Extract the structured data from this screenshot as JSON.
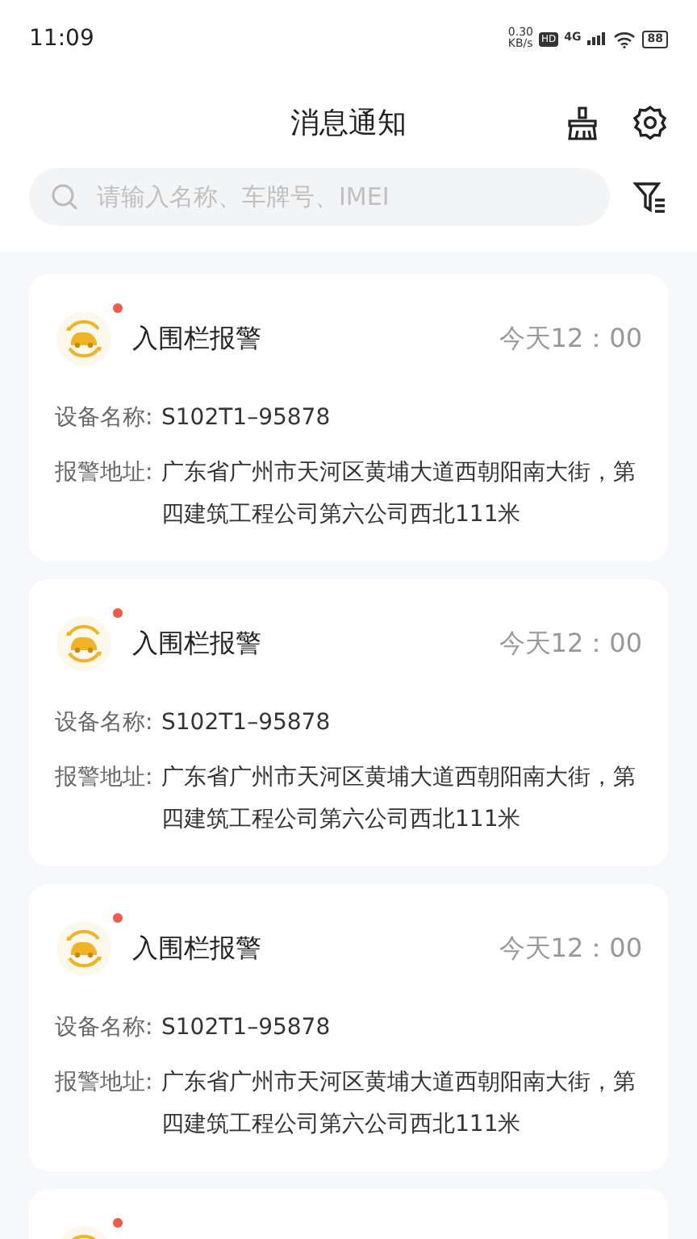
{
  "status_bar": {
    "time": "11:09",
    "speed": "0.30",
    "speed_unit": "KB/s",
    "hd": "HD",
    "network": "4G",
    "battery": "88"
  },
  "header": {
    "title": "消息通知"
  },
  "search": {
    "placeholder": "请输入名称、车牌号、IMEI"
  },
  "messages": [
    {
      "title": "入围栏报警",
      "time": "今天12：00",
      "unread": true,
      "fields": [
        {
          "label": "设备名称:",
          "value": "S102T1–95878"
        },
        {
          "label": "报警地址:",
          "value": "广东省广州市天河区黄埔大道西朝阳南大街，第四建筑工程公司第六公司西北111米"
        }
      ]
    },
    {
      "title": "入围栏报警",
      "time": "今天12：00",
      "unread": true,
      "fields": [
        {
          "label": "设备名称:",
          "value": "S102T1–95878"
        },
        {
          "label": "报警地址:",
          "value": "广东省广州市天河区黄埔大道西朝阳南大街，第四建筑工程公司第六公司西北111米"
        }
      ]
    },
    {
      "title": "入围栏报警",
      "time": "今天12：00",
      "unread": true,
      "fields": [
        {
          "label": "设备名称:",
          "value": "S102T1–95878"
        },
        {
          "label": "报警地址:",
          "value": "广东省广州市天河区黄埔大道西朝阳南大街，第四建筑工程公司第六公司西北111米"
        }
      ]
    },
    {
      "unread": true
    }
  ]
}
